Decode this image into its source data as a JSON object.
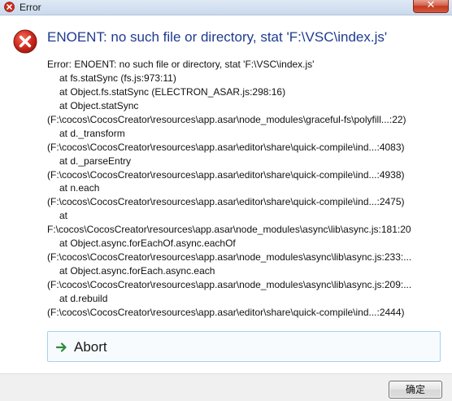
{
  "window": {
    "title": "Error"
  },
  "dialog": {
    "headline": "ENOENT: no such file or directory, stat 'F:\\VSC\\index.js'",
    "details": [
      {
        "text": "Error: ENOENT: no such file or directory, stat 'F:\\VSC\\index.js'",
        "indent": false
      },
      {
        "text": "at fs.statSync (fs.js:973:11)",
        "indent": true
      },
      {
        "text": "at Object.fs.statSync (ELECTRON_ASAR.js:298:16)",
        "indent": true
      },
      {
        "text": "at Object.statSync",
        "indent": true
      },
      {
        "text": "(F:\\cocos\\CocosCreator\\resources\\app.asar\\node_modules\\graceful-fs\\polyfill...:22)",
        "indent": false
      },
      {
        "text": "at d._transform",
        "indent": true
      },
      {
        "text": "(F:\\cocos\\CocosCreator\\resources\\app.asar\\editor\\share\\quick-compile\\ind...:4083)",
        "indent": false
      },
      {
        "text": "at d._parseEntry",
        "indent": true
      },
      {
        "text": "(F:\\cocos\\CocosCreator\\resources\\app.asar\\editor\\share\\quick-compile\\ind...:4938)",
        "indent": false
      },
      {
        "text": "at n.each",
        "indent": true
      },
      {
        "text": "(F:\\cocos\\CocosCreator\\resources\\app.asar\\editor\\share\\quick-compile\\ind...:2475)",
        "indent": false
      },
      {
        "text": "at",
        "indent": true
      },
      {
        "text": "F:\\cocos\\CocosCreator\\resources\\app.asar\\node_modules\\async\\lib\\async.js:181:20",
        "indent": false
      },
      {
        "text": "at Object.async.forEachOf.async.eachOf",
        "indent": true
      },
      {
        "text": "(F:\\cocos\\CocosCreator\\resources\\app.asar\\node_modules\\async\\lib\\async.js:233:...",
        "indent": false
      },
      {
        "text": "at Object.async.forEach.async.each",
        "indent": true
      },
      {
        "text": "(F:\\cocos\\CocosCreator\\resources\\app.asar\\node_modules\\async\\lib\\async.js:209:...",
        "indent": false
      },
      {
        "text": "at d.rebuild",
        "indent": true
      },
      {
        "text": "(F:\\cocos\\CocosCreator\\resources\\app.asar\\editor\\share\\quick-compile\\ind...:2444)",
        "indent": false
      }
    ],
    "abort_label": "Abort",
    "ok_label": "确定"
  },
  "icons": {
    "title": "error-icon",
    "main": "error-icon",
    "abort": "arrow-right-icon",
    "close": "close-icon"
  },
  "colors": {
    "headline": "#1f3b8f",
    "error_red": "#d0291c",
    "abort_arrow": "#2e8b3a"
  }
}
